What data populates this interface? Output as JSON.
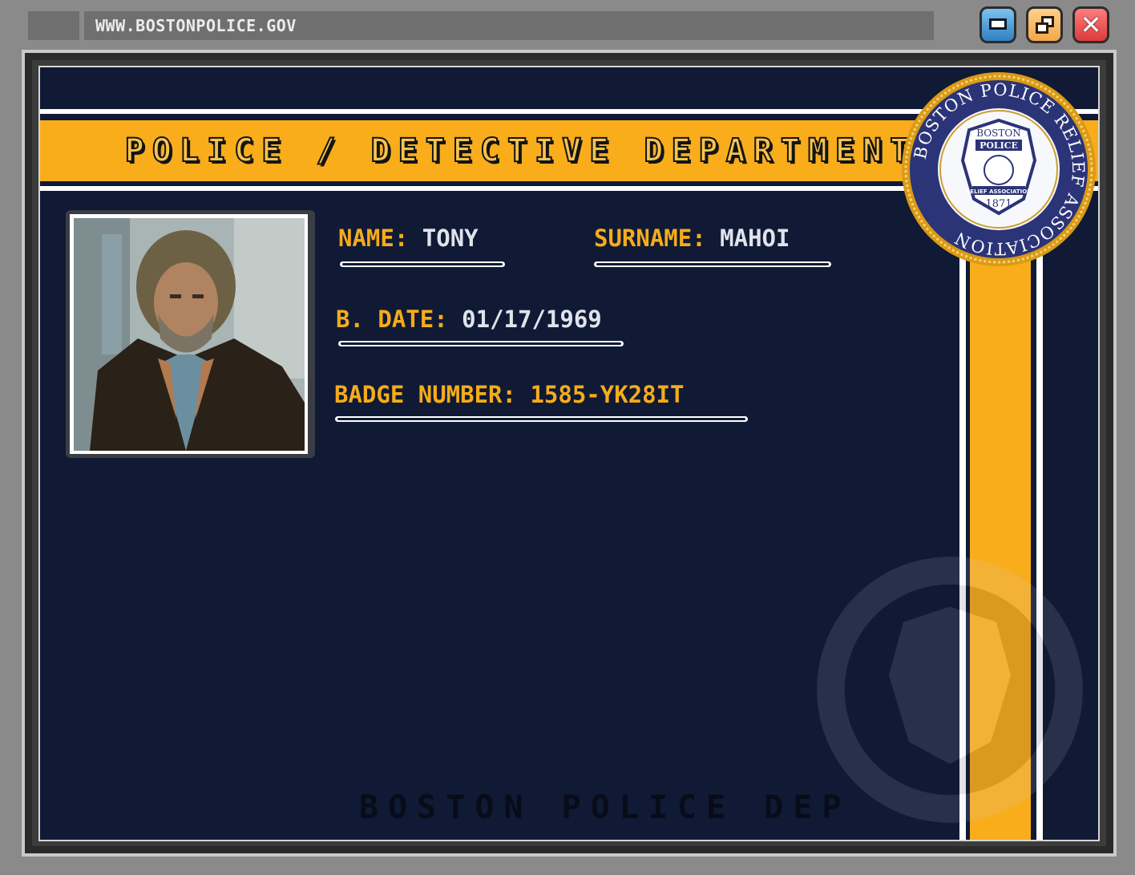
{
  "browser": {
    "url": "WWW.BOSTONPOLICE.GOV",
    "controls": [
      "minimize",
      "restore",
      "close"
    ]
  },
  "header": {
    "title": "POLICE / DETECTIVE DEPARTMENT"
  },
  "profile": {
    "name_label": "NAME:",
    "name_value": "TONY",
    "surname_label": "SURNAME:",
    "surname_value": "MAHOI",
    "birthdate_label": "B. DATE:",
    "birthdate_value": "01/17/1969",
    "badge_label": "BADGE NUMBER:",
    "badge_value": "1585-YK28IT"
  },
  "seal": {
    "ring_text": "BOSTON POLICE RELIEF ASSOCIATION",
    "inner_top": "BOSTON",
    "inner_mid": "POLICE",
    "inner_band": "RELIEF ASSOCIATION",
    "year": "1871"
  },
  "watermark": "BOSTON POLICE DEP",
  "colors": {
    "panel": "#101a34",
    "accent": "#f9ad1b",
    "frame": "#3c3c3c"
  },
  "icons": [
    "minimize-icon",
    "restore-icon",
    "close-icon",
    "police-seal",
    "officer-photo"
  ]
}
